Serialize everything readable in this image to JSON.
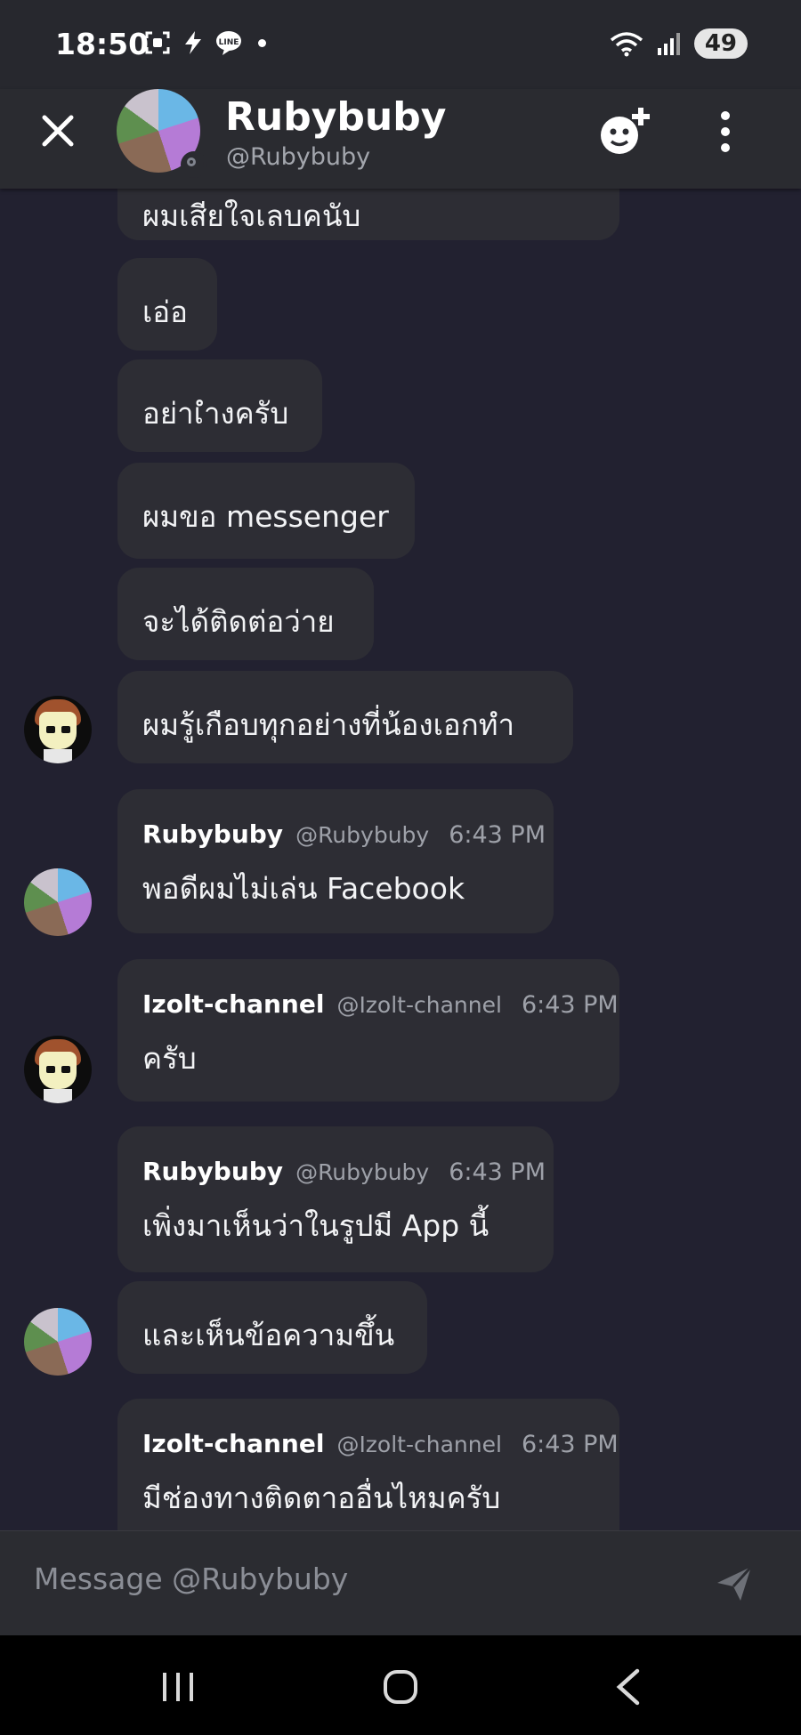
{
  "status_bar": {
    "time": "18:50",
    "icons": [
      "screenshot-icon",
      "bolt-icon",
      "line-app-icon",
      "dot"
    ],
    "battery": "49"
  },
  "header": {
    "name": "Rubybuby",
    "handle": "@Rubybuby",
    "presence": "offline"
  },
  "messages": [
    {
      "text": "ผมเสียใจเลบคนับ"
    },
    {
      "text": "เอ่อ"
    },
    {
      "text": "อย่าเำงครับ"
    },
    {
      "text": "ผมขอ messenger"
    },
    {
      "text": "จะได้ติดต่อว่าย"
    },
    {
      "text": "ผมรู้เกือบทุกอย่างที่น้องเอกทำ"
    },
    {
      "author": "Rubybuby",
      "handle": "@Rubybuby",
      "time": "6:43 PM",
      "text": "พอดีผมไม่เล่น Facebook"
    },
    {
      "author": "Izolt-channel",
      "handle": "@Izolt-channel",
      "time": "6:43 PM",
      "text": "ครับ"
    },
    {
      "author": "Rubybuby",
      "handle": "@Rubybuby",
      "time": "6:43 PM",
      "text": "เพิ่งมาเห็นว่าในรูปมี App นี้"
    },
    {
      "text": "และเห็นข้อความขึ้น"
    },
    {
      "author": "Izolt-channel",
      "handle": "@Izolt-channel",
      "time": "6:43 PM",
      "text": "มีช่องทางติดตาออื่นไหมครับ"
    }
  ],
  "composer": {
    "placeholder": "Message @Rubybuby"
  },
  "colors": {
    "background": "#222130",
    "bubble": "#2d2d34",
    "header": "#2a2b30",
    "muted_text": "#9ea1a9"
  }
}
